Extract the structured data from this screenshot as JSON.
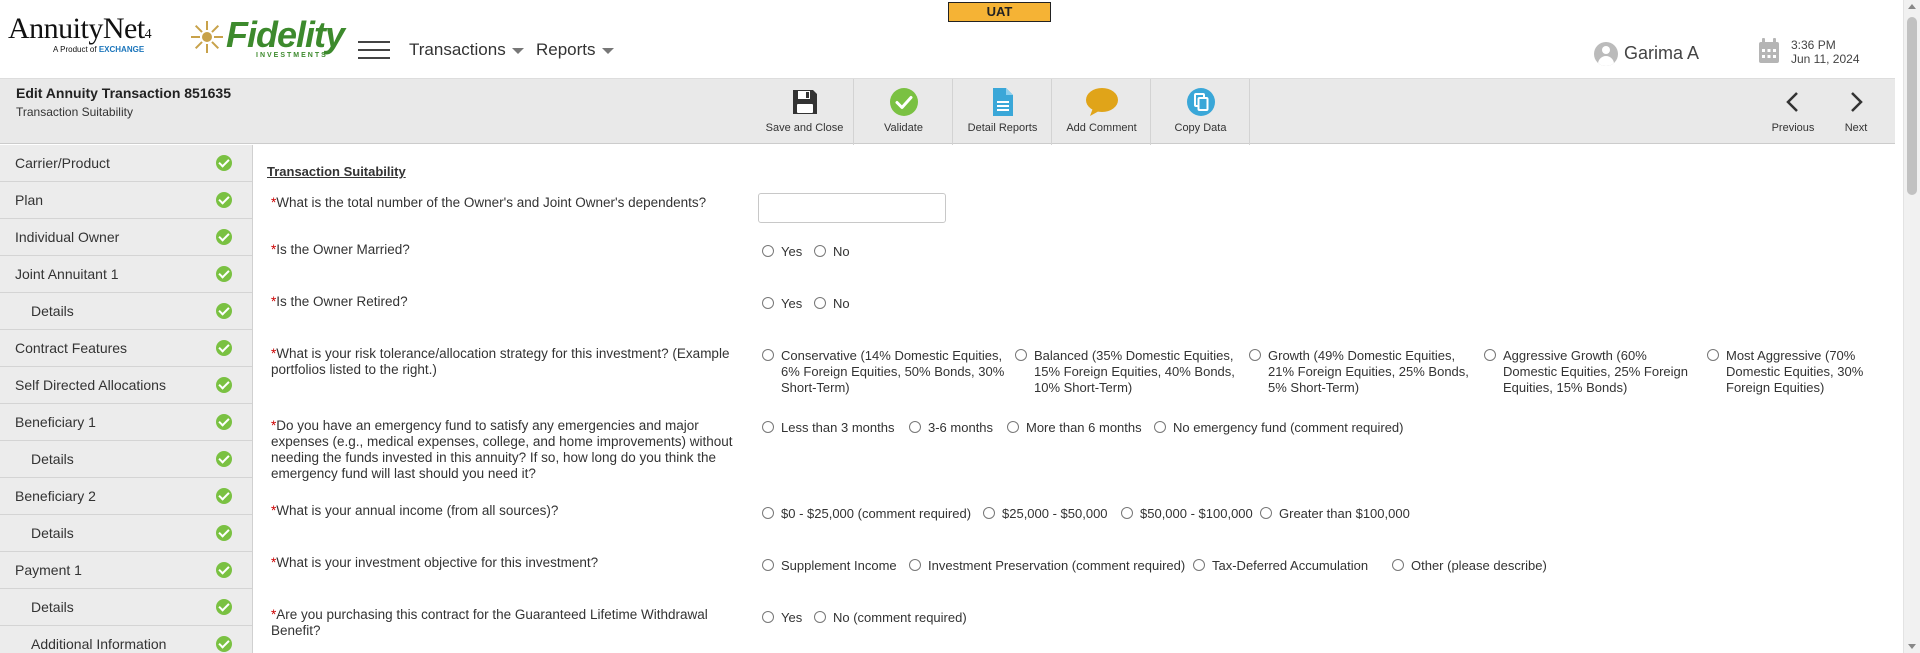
{
  "env_badge": "UAT",
  "logos": {
    "annuitynet": "AnnuityNet",
    "annuitynet_version": "4",
    "annuitynet_sub_prefix": "A Product of",
    "annuitynet_sub_brand": "EXCHANGE",
    "fidelity": "Fidelity",
    "fidelity_sub": "INVESTMENTS"
  },
  "nav": {
    "transactions": "Transactions",
    "reports": "Reports"
  },
  "user": {
    "name": "Garima A"
  },
  "clock": {
    "time": "3:36 PM",
    "date": "Jun 11, 2024"
  },
  "toolbar": {
    "title": "Edit Annuity Transaction 851635",
    "subtitle": "Transaction Suitability",
    "save_close": "Save and Close",
    "validate": "Validate",
    "detail_reports": "Detail Reports",
    "add_comment": "Add Comment",
    "copy_data": "Copy Data",
    "previous": "Previous",
    "next": "Next"
  },
  "sidebar": {
    "items": [
      {
        "label": "Carrier/Product"
      },
      {
        "label": "Plan"
      },
      {
        "label": "Individual Owner"
      },
      {
        "label": "Joint Annuitant 1"
      },
      {
        "label": "Details"
      },
      {
        "label": "Contract Features"
      },
      {
        "label": "Self Directed Allocations"
      },
      {
        "label": "Beneficiary 1"
      },
      {
        "label": "Details"
      },
      {
        "label": "Beneficiary 2"
      },
      {
        "label": "Details"
      },
      {
        "label": "Payment 1"
      },
      {
        "label": "Details"
      },
      {
        "label": "Additional Information"
      }
    ]
  },
  "form": {
    "section_title": "Transaction Suitability",
    "required_mark": "*",
    "questions": [
      {
        "text": "What is the total number of the Owner's and Joint Owner's dependents?",
        "input_value": ""
      },
      {
        "text": "Is the Owner Married?",
        "options": [
          "Yes",
          "No"
        ]
      },
      {
        "text": "Is the Owner Retired?",
        "options": [
          "Yes",
          "No"
        ]
      },
      {
        "text": "What is your risk tolerance/allocation strategy for this investment? (Example portfolios listed to the right.)",
        "options": [
          "Conservative (14% Domestic Equities, 6% Foreign Equities, 50% Bonds, 30% Short-Term)",
          "Balanced (35% Domestic Equities, 15% Foreign Equities, 40% Bonds, 10% Short-Term)",
          "Growth (49% Domestic Equities, 21% Foreign Equities, 25% Bonds, 5% Short-Term)",
          "Aggressive Growth (60% Domestic Equities, 25% Foreign Equities, 15% Bonds)",
          "Most Aggressive (70% Domestic Equities, 30% Foreign Equities)"
        ]
      },
      {
        "text": "Do you have an emergency fund to satisfy any emergencies and major expenses (e.g., medical expenses, college, and home improvements) without needing the funds invested in this annuity? If so, how long do you think the emergency fund will last should you need it?",
        "options": [
          "Less than 3 months",
          "3-6 months",
          "More than 6 months",
          "No emergency fund (comment required)"
        ]
      },
      {
        "text": "What is your annual income (from all sources)?",
        "options": [
          "$0 - $25,000 (comment required)",
          "$25,000 - $50,000",
          "$50,000 - $100,000",
          "Greater than $100,000"
        ]
      },
      {
        "text": "What is your investment objective for this investment?",
        "options": [
          "Supplement Income",
          "Investment Preservation (comment required)",
          "Tax-Deferred Accumulation",
          "Other (please describe)"
        ]
      },
      {
        "text": "Are you purchasing this contract for the Guaranteed Lifetime Withdrawal Benefit?",
        "options": [
          "Yes",
          "No (comment required)"
        ]
      }
    ]
  },
  "colors": {
    "accent_green": "#7ac142",
    "detail_blue": "#3aa7d8",
    "comment_gold": "#e0a419",
    "env_badge": "#f5b335",
    "required_red": "#cc0000"
  }
}
